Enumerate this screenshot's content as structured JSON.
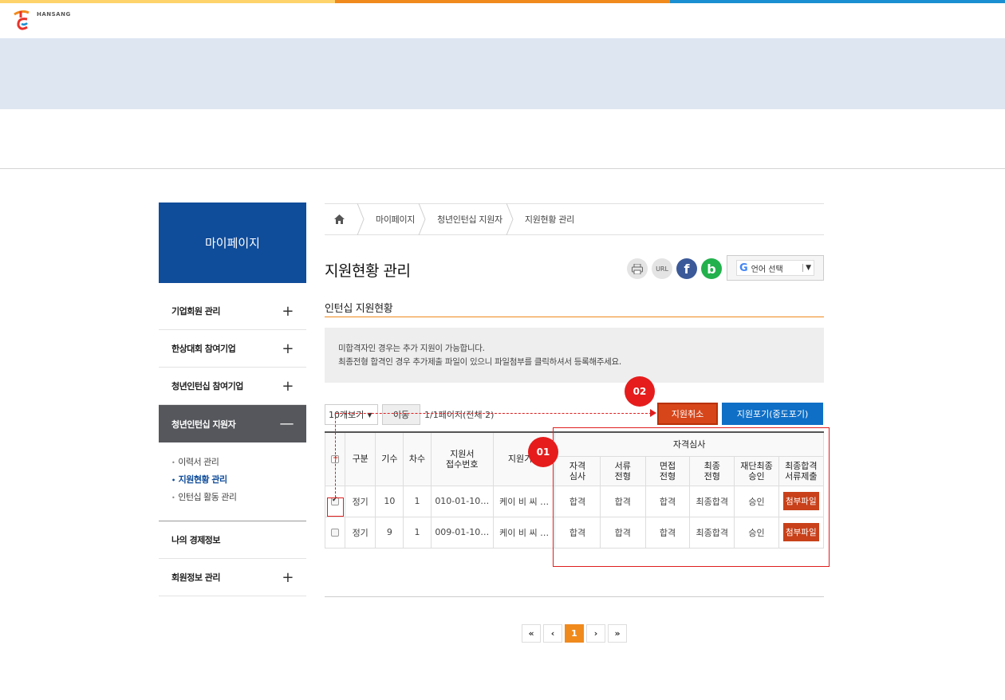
{
  "brand": {
    "logo_text": "HANSANG"
  },
  "sidebar": {
    "title": "마이페이지",
    "items": [
      {
        "label": "기업회원 관리",
        "toggle": "+"
      },
      {
        "label": "한상대회 참여기업",
        "toggle": "+"
      },
      {
        "label": "청년인턴십 참여기업",
        "toggle": "+"
      },
      {
        "label": "청년인턴십 지원자",
        "toggle": "—"
      }
    ],
    "sub_items": [
      {
        "label": "이력서 관리"
      },
      {
        "label": "지원현황 관리"
      },
      {
        "label": "인턴십 활동 관리"
      }
    ],
    "bottom_items": [
      {
        "label": "나의 경제정보",
        "toggle": ""
      },
      {
        "label": "회원정보 관리",
        "toggle": "+"
      }
    ]
  },
  "breadcrumb": [
    "마이페이지",
    "청년인턴십 지원자",
    "지원현황 관리"
  ],
  "page": {
    "title": "지원현황 관리",
    "subtitle": "인턴십 지원현황",
    "notice": [
      "미합격자인 경우는 추가 지원이 가능합니다.",
      "최종전형 합격인 경우 추가제출 파일이 있으니 파일첨부를 클릭하셔서 등록해주세요."
    ]
  },
  "share": {
    "url_label": "URL",
    "facebook": "f",
    "band": "b"
  },
  "language": {
    "g": "G",
    "label": "언어 선택",
    "arrow": "▼"
  },
  "controls": {
    "per_page": "10개보기",
    "move_button": "이동",
    "page_info": "1/1페이지(전체 2)",
    "cancel_button": "지원취소",
    "giveup_button": "지원포기(중도포기)"
  },
  "table": {
    "headers": {
      "type": "구분",
      "gen": "기수",
      "round": "차수",
      "receipt": "지원서\n접수번호",
      "company": "지원기업",
      "group": "자격심사",
      "qual": "자격\n심사",
      "doc": "서류\n전형",
      "interview": "면접\n전형",
      "final": "최종\n전형",
      "approve": "재단최종\n승인",
      "submit": "최종합격\n서류제출"
    },
    "rows": [
      {
        "checked": true,
        "type": "정기",
        "gen": "10",
        "round": "1",
        "receipt": "010-01-10…",
        "company": "케이 비 씨 …",
        "qual": "합격",
        "doc": "합격",
        "interview": "합격",
        "final": "최종합격",
        "approve": "승인",
        "submit": "첨부파일"
      },
      {
        "checked": false,
        "type": "정기",
        "gen": "9",
        "round": "1",
        "receipt": "009-01-10…",
        "company": "케이 비 씨 …",
        "qual": "합격",
        "doc": "합격",
        "interview": "합격",
        "final": "최종합격",
        "approve": "승인",
        "submit": "첨부파일"
      }
    ]
  },
  "annotations": {
    "badge1": "01",
    "badge2": "02"
  },
  "pagination": {
    "first": "«",
    "prev": "‹",
    "current": "1",
    "next": "›",
    "last": "»"
  },
  "colors": {
    "primary_blue": "#0f4c9a",
    "accent_orange": "#f08a1d",
    "cancel_red": "#d6461a",
    "giveup_blue": "#0f6fc6",
    "annotation_red": "#e01e1e"
  }
}
